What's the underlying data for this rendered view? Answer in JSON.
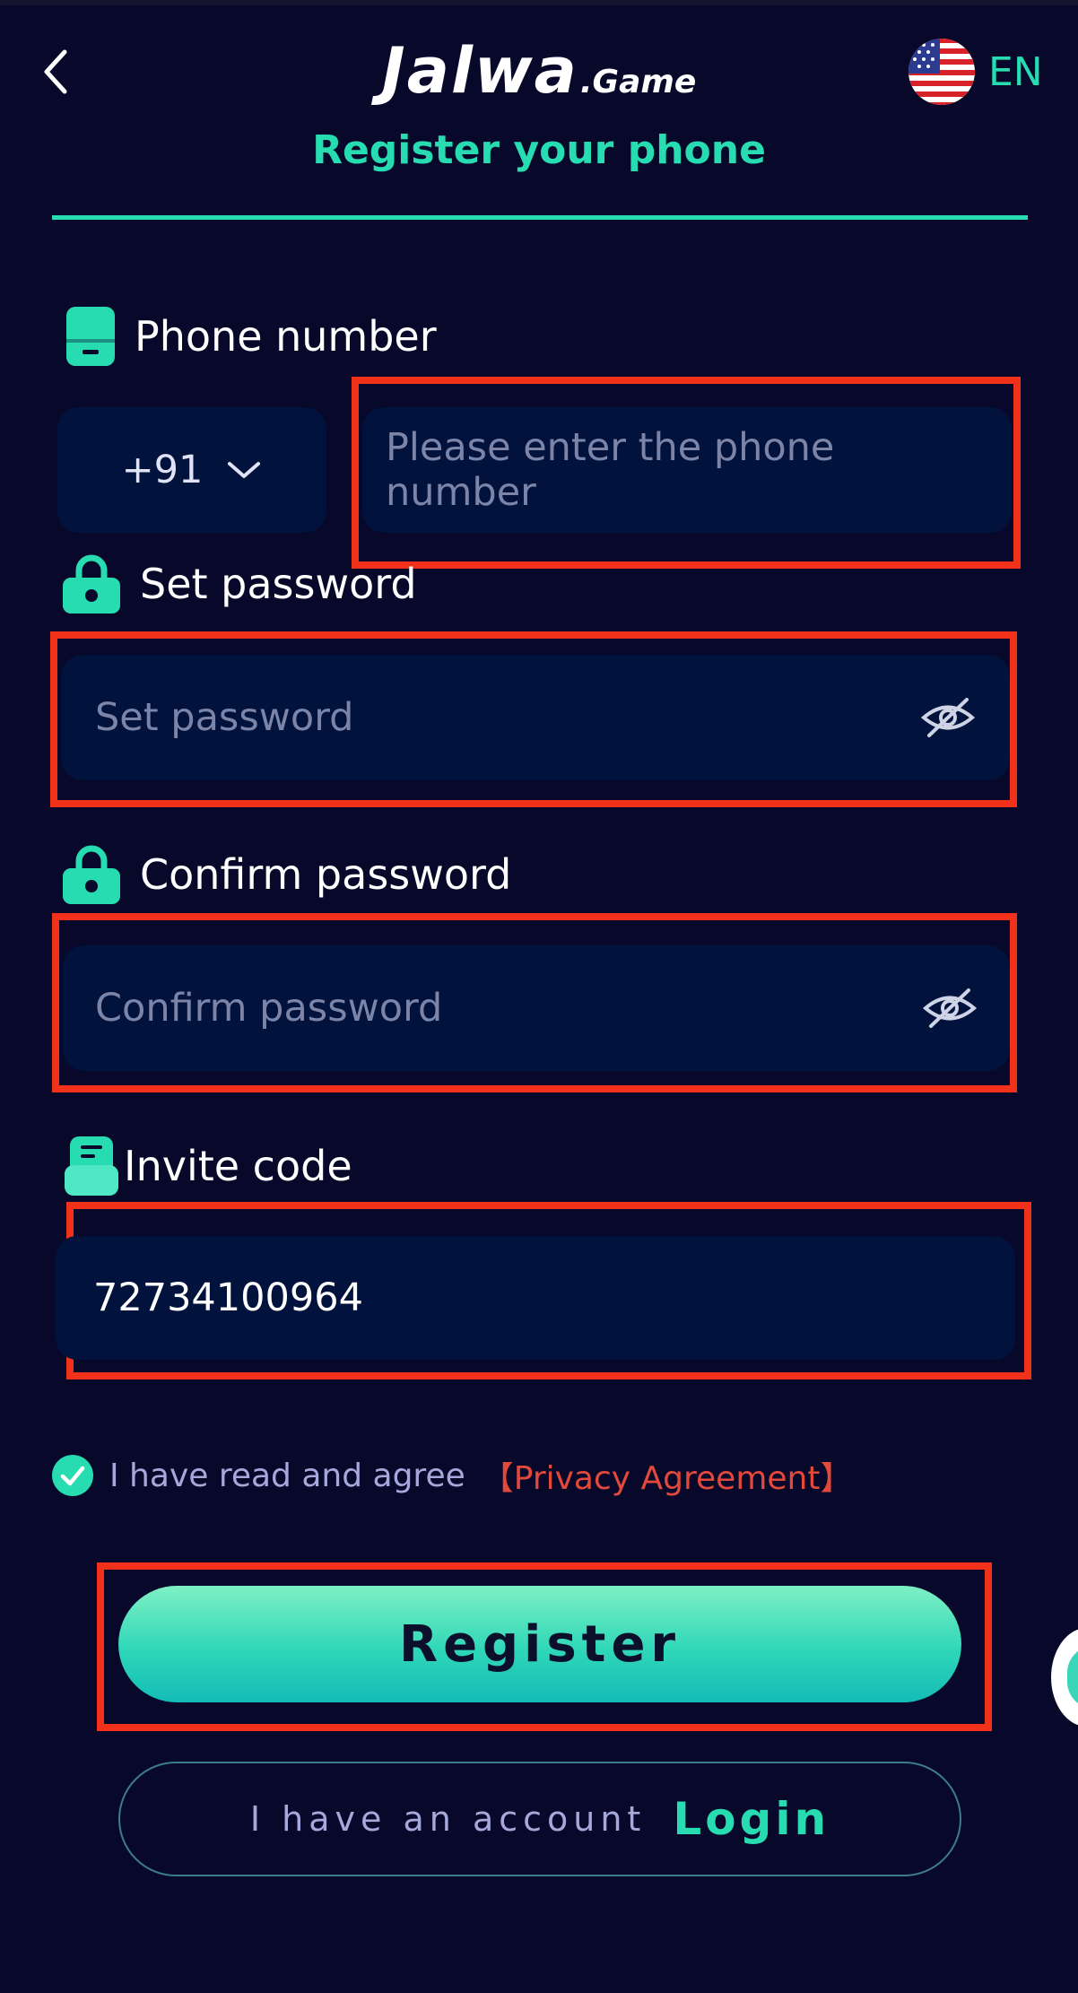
{
  "header": {
    "logo_main": "Jalwa",
    "logo_sub": ".Game",
    "language_label": "EN",
    "tab_title": "Register your phone"
  },
  "phone": {
    "label": "Phone number",
    "country_code": "+91",
    "placeholder": "Please enter the phone number"
  },
  "password": {
    "label": "Set password",
    "placeholder": "Set password"
  },
  "confirm_password": {
    "label": "Confirm password",
    "placeholder": "Confirm password"
  },
  "invite": {
    "label": "Invite code",
    "value": "72734100964"
  },
  "agreement": {
    "text": "I have read and agree",
    "link": "【Privacy Agreement】",
    "checked": true
  },
  "actions": {
    "register_label": "Register",
    "login_prompt": "I have an account",
    "login_label": "Login"
  },
  "colors": {
    "background": "#07082a",
    "accent": "#27dcb0",
    "field": "#01123c",
    "link": "#e3493a",
    "highlight": "#f2311a"
  }
}
